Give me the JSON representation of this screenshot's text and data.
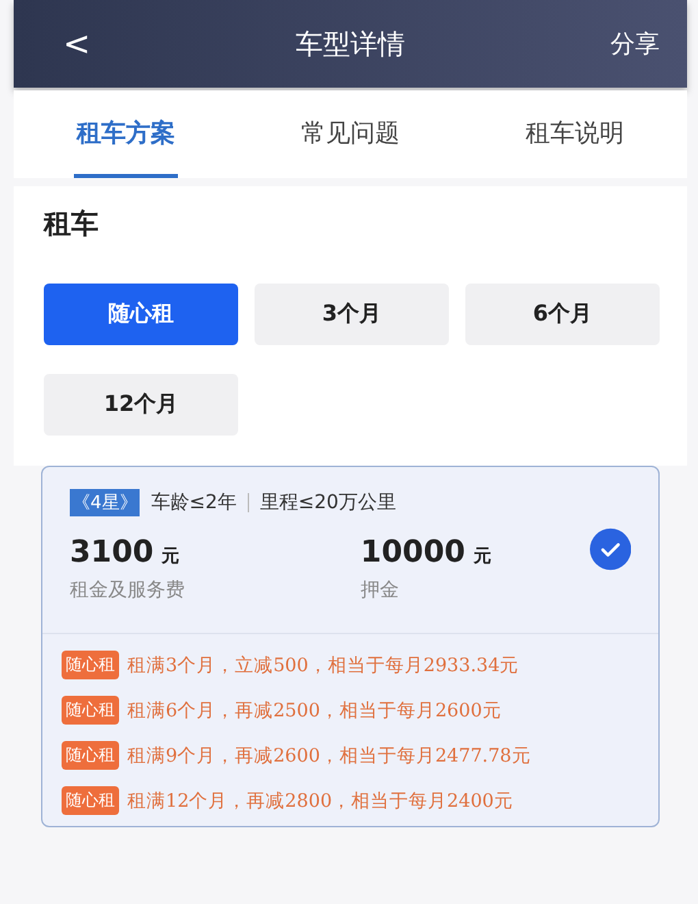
{
  "header": {
    "back": "<",
    "title": "车型详情",
    "action": "分享"
  },
  "tabs": [
    {
      "label": "租车方案",
      "selected": true
    },
    {
      "label": "常见问题",
      "selected": false
    },
    {
      "label": "租车说明",
      "selected": false
    }
  ],
  "section_title": "租车",
  "plans": [
    {
      "label": "随心租",
      "selected": true
    },
    {
      "label": "3个月",
      "selected": false
    },
    {
      "label": "6个月",
      "selected": false
    },
    {
      "label": "12个月",
      "selected": false
    }
  ],
  "card": {
    "selected": true,
    "star_tag": "《4星》",
    "age": "车龄≤2年",
    "mileage": "里程≤20万公里",
    "prices": [
      {
        "amount": "3100",
        "unit": "元",
        "label": "租金及服务费"
      },
      {
        "amount": "10000",
        "unit": "元",
        "label": "押金"
      }
    ],
    "offers": [
      {
        "tag": "随心租",
        "text": "租满3个月，立减500，相当于每月2933.34元"
      },
      {
        "tag": "随心租",
        "text": "租满6个月，再减2500，相当于每月2600元"
      },
      {
        "tag": "随心租",
        "text": "租满9个月，再减2600，相当于每月2477.78元"
      },
      {
        "tag": "随心租",
        "text": "租满12个月，再减2800，相当于每月2400元"
      }
    ]
  }
}
